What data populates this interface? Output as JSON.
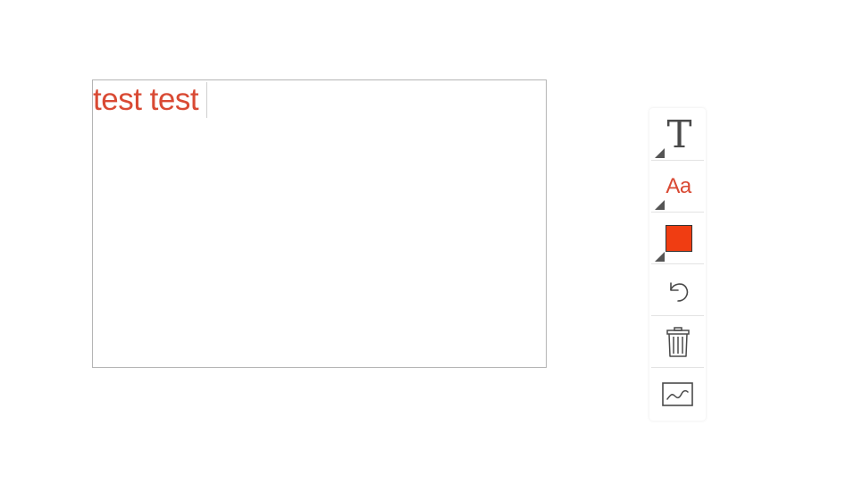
{
  "editor": {
    "text": "test test",
    "text_color": "#d94a34"
  },
  "toolbar": {
    "tools": [
      {
        "name": "text-tool",
        "glyph": "T",
        "icon": "text-tool-icon"
      },
      {
        "name": "font-tool",
        "glyph": "Aa",
        "icon": "font-size-icon"
      },
      {
        "name": "color-tool",
        "icon": "color-swatch-icon",
        "color": "#f03d12"
      },
      {
        "name": "undo-tool",
        "icon": "undo-icon"
      },
      {
        "name": "delete-tool",
        "icon": "trash-icon"
      },
      {
        "name": "signature-tool",
        "icon": "signature-icon"
      }
    ]
  },
  "colors": {
    "border": "#b5b5b5",
    "icon": "#4a4a4a",
    "corner_marker": "#555555"
  }
}
